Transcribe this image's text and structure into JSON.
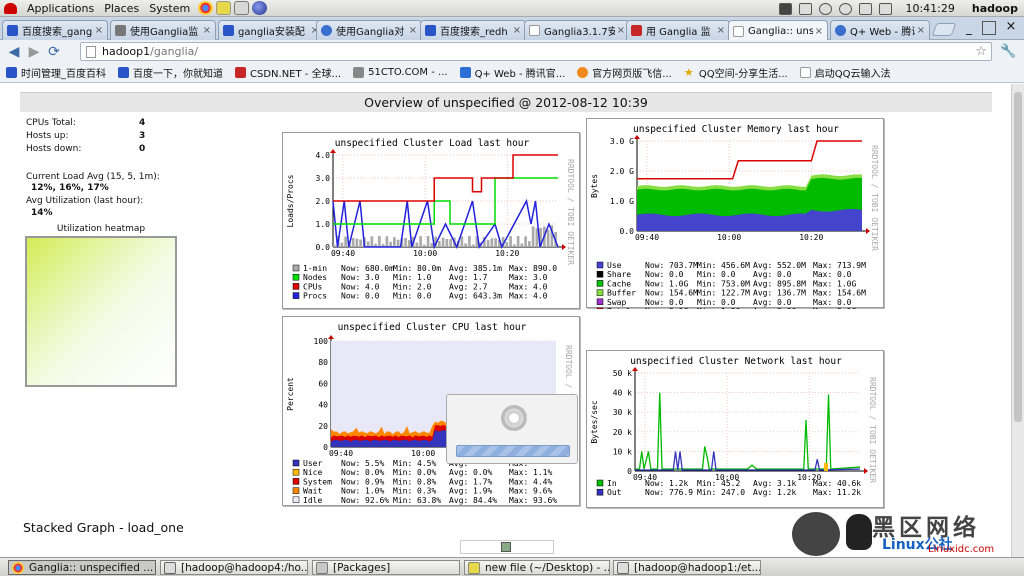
{
  "panel": {
    "menus": [
      "Applications",
      "Places",
      "System"
    ],
    "time": "10:41:29",
    "user": "hadoop"
  },
  "tabs": [
    {
      "label": "百度搜索_gang",
      "icon": "paw-icon",
      "color": "#2a55c9"
    },
    {
      "label": "使用Ganglia监",
      "icon": "document-icon",
      "color": "#777777"
    },
    {
      "label": "ganglia安装配",
      "icon": "paw-icon",
      "color": "#2a55c9"
    },
    {
      "label": "使用Ganglia对",
      "icon": "globe-icon",
      "color": "#3a6fd0"
    },
    {
      "label": "百度搜索_redh",
      "icon": "paw-icon",
      "color": "#2a55c9"
    },
    {
      "label": "Ganglia3.1.7安",
      "icon": "page-icon",
      "color": "#bbbbbb"
    },
    {
      "label": "用 Ganglia 监",
      "icon": "c-logo-icon",
      "color": "#c62828"
    },
    {
      "label": "Ganglia:: unsp",
      "icon": "page-icon",
      "color": "#bbbbbb",
      "active": true
    },
    {
      "label": "Q+ Web - 腾讯",
      "icon": "globe-icon",
      "color": "#3a6fd0"
    }
  ],
  "address": {
    "host": "hadoop1",
    "path": "/ganglia/"
  },
  "bookmarks": [
    {
      "label": "时间管理_百度百科",
      "icon": "paw-icon",
      "color": "#2a55c9"
    },
    {
      "label": "百度一下，你就知道",
      "icon": "paw-icon",
      "color": "#2a55c9"
    },
    {
      "label": "CSDN.NET - 全球...",
      "icon": "c-logo-icon",
      "color": "#c62828"
    },
    {
      "label": "51CTO.COM - ...",
      "icon": "tools-icon",
      "color": "#888888"
    },
    {
      "label": "Q+ Web - 腾讯官...",
      "icon": "q-logo-icon",
      "color": "#2b6fd6"
    },
    {
      "label": "官方网页版飞信...",
      "icon": "fetion-icon",
      "color": "#f08a1c"
    },
    {
      "label": "QQ空间-分享生活...",
      "icon": "star-icon",
      "color": "#e0a800"
    },
    {
      "label": "启动QQ云输入法",
      "icon": "page-icon",
      "color": "#bbbbbb"
    }
  ],
  "page": {
    "overview_title": "Overview of unspecified @ 2012-08-12 10:39",
    "stats": [
      {
        "label": "CPUs Total:",
        "value": "4"
      },
      {
        "label": "Hosts up:",
        "value": "3"
      },
      {
        "label": "Hosts down:",
        "value": "0"
      }
    ],
    "load_label": "Current Load Avg (15, 5, 1m):",
    "load_value": "12%, 16%, 17%",
    "util_label": "Avg Utilization (last hour):",
    "util_value": "14%",
    "heatmap_title": "Utilization heatmap",
    "stacked_title": "Stacked Graph - load_one",
    "watermark_side": "RRDTOOL / TOBI OETIKER"
  },
  "graphs": {
    "load": {
      "title": "unspecified Cluster Load last hour",
      "ylabel": "Loads/Procs",
      "yticks": [
        "4.0",
        "3.0",
        "2.0",
        "1.0",
        "0.0"
      ],
      "xticks": [
        "09:40",
        "10:00",
        "10:20"
      ],
      "legend": [
        {
          "name": "1-min",
          "color": "#aaaaaa",
          "now": "680.0m",
          "min": "80.0m",
          "avg": "385.1m",
          "max": "890.0"
        },
        {
          "name": "Nodes",
          "color": "#00dd00",
          "now": "3.0",
          "min": "1.0",
          "avg": "1.7",
          "max": "3.0"
        },
        {
          "name": "CPUs",
          "color": "#dd0000",
          "now": "4.0",
          "min": "2.0",
          "avg": "2.7",
          "max": "4.0"
        },
        {
          "name": "Procs",
          "color": "#2222dd",
          "now": "0.0",
          "min": "0.0",
          "avg": "643.3m",
          "max": "4.0"
        }
      ]
    },
    "memory": {
      "title": "unspecified Cluster Memory last hour",
      "ylabel": "Bytes",
      "yticks": [
        "3.0 G",
        "2.0 G",
        "1.0 G",
        "0.0"
      ],
      "xticks": [
        "09:40",
        "10:00",
        "10:20"
      ],
      "legend": [
        {
          "name": "Use",
          "color": "#4444cc",
          "now": "703.7M",
          "min": "456.6M",
          "avg": "552.0M",
          "max": "713.9M"
        },
        {
          "name": "Share",
          "color": "#000000",
          "now": "0.0",
          "min": "0.0",
          "avg": "0.0",
          "max": "0.0"
        },
        {
          "name": "Cache",
          "color": "#00bb00",
          "now": "1.0G",
          "min": "753.0M",
          "avg": "895.8M",
          "max": "1.0G"
        },
        {
          "name": "Buffer",
          "color": "#88dd44",
          "now": "154.6M",
          "min": "122.7M",
          "avg": "136.7M",
          "max": "154.6M"
        },
        {
          "name": "Swap",
          "color": "#9933cc",
          "now": "0.0",
          "min": "0.0",
          "avg": "0.0",
          "max": "0.0"
        },
        {
          "name": "Total",
          "color": "#dd0000",
          "now": "3.1G",
          "min": "1.8G",
          "avg": "2.3G",
          "max": "3.1G"
        }
      ]
    },
    "cpu": {
      "title": "unspecified Cluster CPU last hour",
      "ylabel": "Percent",
      "yticks": [
        "100",
        "80",
        "60",
        "40",
        "20",
        "0"
      ],
      "xticks": [
        "09:40",
        "10:00",
        "10:20"
      ],
      "legend": [
        {
          "name": "User",
          "color": "#3333bb",
          "now": "5.5%",
          "min": "4.5%",
          "avg": "",
          "max": ""
        },
        {
          "name": "Nice",
          "color": "#ffbb00",
          "now": "0.0%",
          "min": "0.0%",
          "avg": "0.0%",
          "max": "1.1%"
        },
        {
          "name": "System",
          "color": "#dd0000",
          "now": "0.9%",
          "min": "0.8%",
          "avg": "1.7%",
          "max": "4.4%"
        },
        {
          "name": "Wait",
          "color": "#ff8800",
          "now": "1.0%",
          "min": "0.3%",
          "avg": "1.9%",
          "max": "9.6%"
        },
        {
          "name": "Idle",
          "color": "#e8e8f8",
          "now": "92.6%",
          "min": "63.8%",
          "avg": "84.4%",
          "max": "93.6%"
        }
      ]
    },
    "network": {
      "title": "unspecified Cluster Network last hour",
      "ylabel": "Bytes/sec",
      "yticks": [
        "50 k",
        "40 k",
        "30 k",
        "20 k",
        "10 k",
        "0"
      ],
      "xticks": [
        "09:40",
        "10:00",
        "10:20"
      ],
      "legend": [
        {
          "name": "In",
          "color": "#00bb00",
          "now": "1.2k",
          "min": "45.2",
          "avg": "3.1k",
          "max": "40.6k"
        },
        {
          "name": "Out",
          "color": "#3333bb",
          "now": "776.9",
          "min": "247.0",
          "avg": "1.2k",
          "max": "11.2k"
        }
      ]
    }
  },
  "legend_headers": {
    "now": "Now:",
    "min": "Min:",
    "avg": "Avg:",
    "max": "Max:"
  },
  "taskbar": [
    {
      "label": "Ganglia:: unspecified ...",
      "icon": "chrome-icon",
      "active": true
    },
    {
      "label": "[hadoop@hadoop4:/ho...",
      "icon": "terminal-icon"
    },
    {
      "label": "[Packages]",
      "icon": "folder-icon"
    },
    {
      "label": "new file (~/Desktop) - ...",
      "icon": "editor-icon"
    },
    {
      "label": "[hadoop@hadoop1:/et...",
      "icon": "terminal-icon"
    }
  ],
  "watermark": {
    "brand": "黑区网络",
    "site": "Linuxidc.com",
    "sub": "Linux公社"
  }
}
